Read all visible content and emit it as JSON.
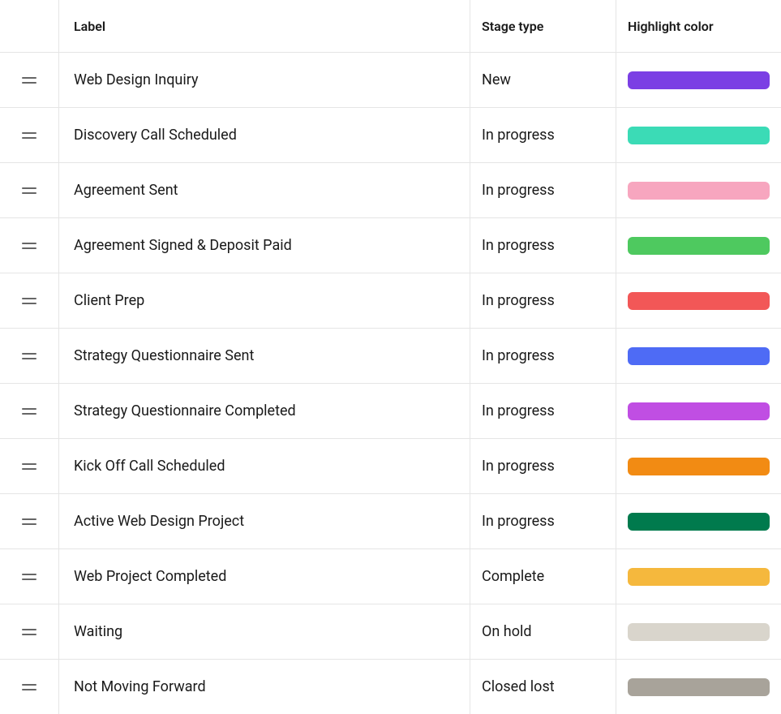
{
  "columns": {
    "label": "Label",
    "stage": "Stage type",
    "color": "Highlight color"
  },
  "rows": [
    {
      "label": "Web Design Inquiry",
      "stage": "New",
      "color": "#7B3FE4"
    },
    {
      "label": "Discovery Call Scheduled",
      "stage": "In progress",
      "color": "#3BDBB6"
    },
    {
      "label": "Agreement Sent",
      "stage": "In progress",
      "color": "#F7A6BF"
    },
    {
      "label": "Agreement Signed & Deposit Paid",
      "stage": "In progress",
      "color": "#4EC95F"
    },
    {
      "label": "Client Prep",
      "stage": "In progress",
      "color": "#F25757"
    },
    {
      "label": "Strategy Questionnaire Sent",
      "stage": "In progress",
      "color": "#4E6BF5"
    },
    {
      "label": "Strategy Questionnaire Completed",
      "stage": "In progress",
      "color": "#C04EE3"
    },
    {
      "label": "Kick Off Call Scheduled",
      "stage": "In progress",
      "color": "#F28B13"
    },
    {
      "label": "Active Web Design Project",
      "stage": "In progress",
      "color": "#007A4D"
    },
    {
      "label": "Web Project Completed",
      "stage": "Complete",
      "color": "#F5B83D"
    },
    {
      "label": "Waiting",
      "stage": "On hold",
      "color": "#D9D5CC"
    },
    {
      "label": "Not Moving Forward",
      "stage": "Closed lost",
      "color": "#A8A39A"
    }
  ]
}
